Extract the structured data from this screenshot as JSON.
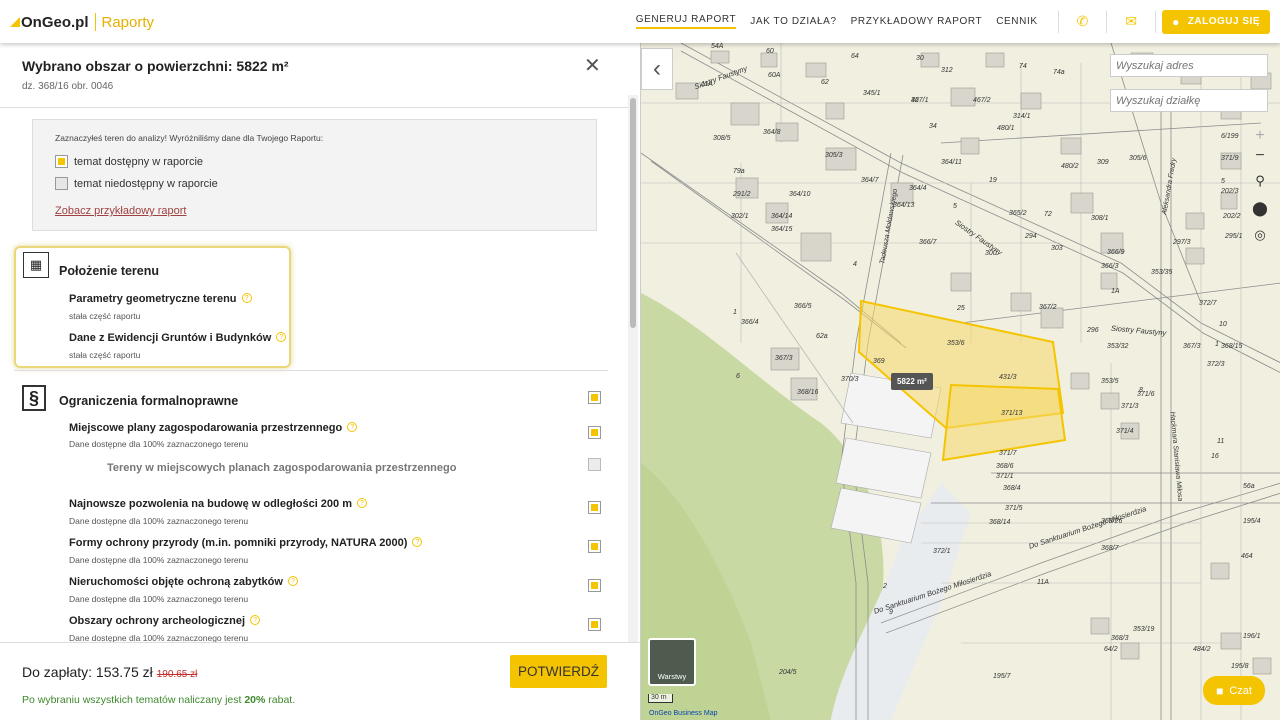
{
  "header": {
    "logo": "OnGeo.pl",
    "logo_sub": "Raporty",
    "nav": [
      "GENERUJ RAPORT",
      "JAK TO DZIAŁA?",
      "PRZYKŁADOWY RAPORT",
      "CENNIK"
    ],
    "login": "ZALOGUJ SIĘ",
    "icons": [
      "phone-icon",
      "mail-icon",
      "user-icon"
    ]
  },
  "selection": {
    "title": "Wybrano obszar o powierzchni: 5822 m²",
    "parcel": "dz. 368/16 obr. 0046",
    "close": "✕"
  },
  "info": {
    "heading": "Zaznaczyłeś teren do analizy! Wyróżniliśmy dane dla Twojego Raportu:",
    "available": "temat dostępny w raporcie",
    "unavailable": "temat niedostępny w raporcie",
    "link": "Zobacz przykładowy raport"
  },
  "section1": {
    "title": "Położenie terenu",
    "items": [
      {
        "title": "Parametry geometryczne terenu",
        "sub": "stała część raportu"
      },
      {
        "title": "Dane z Ewidencji Gruntów i Budynków",
        "sub": "stała część raportu"
      }
    ]
  },
  "section2": {
    "title": "Ograniczenia formalnoprawne",
    "icon": "§",
    "items": [
      {
        "title": "Miejscowe plany zagospodarowania przestrzennego",
        "sub": "Dane dostępne dla 100% zaznaczonego terenu"
      },
      {
        "title": "Tereny w miejscowych planach zagospodarowania przestrzennego"
      },
      {
        "title": "Najnowsze pozwolenia na budowę w odległości 200 m",
        "sub": "Dane dostępne dla 100% zaznaczonego terenu"
      },
      {
        "title": "Formy ochrony przyrody (m.in. pomniki przyrody, NATURA 2000)",
        "sub": "Dane dostępne dla 100% zaznaczonego terenu"
      },
      {
        "title": "Nieruchomości objęte ochroną zabytków",
        "sub": "Dane dostępne dla 100% zaznaczonego terenu"
      },
      {
        "title": "Obszary ochrony archeologicznej",
        "sub": "Dane dostępne dla 100% zaznaczonego terenu"
      }
    ]
  },
  "footer": {
    "pay_label": "Do zapłaty: 153.75 zł",
    "old_price": "190.65 zł",
    "confirm": "POTWIERDŹ",
    "rabat_prefix": "Po wybraniu wszystkich tematów naliczany jest",
    "rabat_value": "20%",
    "rabat_suffix": "rabat."
  },
  "map": {
    "address_placeholder": "Wyszukaj adres",
    "parcel_placeholder": "Wyszukaj działkę",
    "area_badge": "5822 m²",
    "layers": "Warstwy",
    "scale": "30 m",
    "attribution": "OnGeo Business Map",
    "chat": "Czat",
    "labels": [
      "54A",
      "60",
      "64",
      "30",
      "312",
      "62",
      "60A",
      "11A",
      "345/1",
      "467/1",
      "32",
      "364/8",
      "34",
      "467/2",
      "480/1",
      "314/1",
      "74",
      "74a",
      "308/5",
      "305/3",
      "364/7",
      "364/4",
      "364/11",
      "19",
      "480/2",
      "309",
      "305/6",
      "79a",
      "291/2",
      "364/10",
      "364/13",
      "5",
      "365/2",
      "72",
      "308/1",
      "302/1",
      "364/14",
      "364/15",
      "366/7",
      "4",
      "303",
      "300",
      "294",
      "366/3",
      "366/9",
      "297/3",
      "1A",
      "353/35",
      "1",
      "366/4",
      "366/5",
      "25",
      "367/2",
      "296",
      "353/32",
      "367/3",
      "62a",
      "353/6",
      "368/15",
      "367/3",
      "369",
      "431/3",
      "353/5",
      "8",
      "6",
      "368/16",
      "370/3",
      "371/13",
      "371/3",
      "371/4",
      "371/6",
      "371/7",
      "368/6",
      "371/1",
      "368/4",
      "371/5",
      "353/26",
      "368/14",
      "368/7",
      "372/1",
      "2",
      "9",
      "11A",
      "353/19",
      "368/3",
      "64/2",
      "484/2",
      "204/5",
      "195/7",
      "195/8",
      "196/1",
      "464",
      "56a",
      "195/4",
      "6/199",
      "371/9",
      "5",
      "202/3",
      "202/2",
      "295/1",
      "372/7",
      "10",
      "1",
      "372/3",
      "11",
      "16"
    ],
    "streets": [
      "Siostry Faustyny",
      "Tadeusza Mołdawskiego",
      "Do Sanktuarium Bożego Miłosierdzia",
      "Aleksandra Fredry",
      "Hackmara Stanisława Miłosa"
    ]
  }
}
